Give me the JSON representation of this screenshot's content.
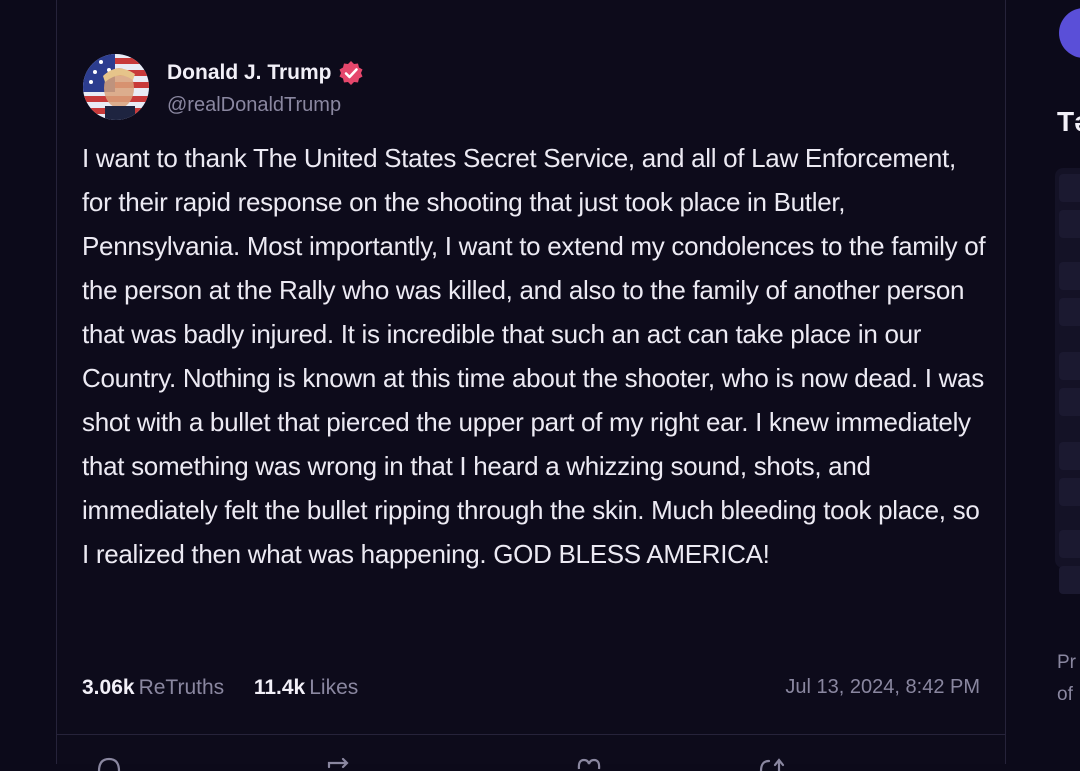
{
  "post": {
    "author": {
      "display_name": "Donald J. Trump",
      "handle": "@realDonaldTrump",
      "verified": true,
      "verified_color": "#e5476c"
    },
    "text": "I want to thank The United States Secret Service, and all of Law Enforcement, for their rapid response on the shooting that just took place in Butler, Pennsylvania. Most importantly, I want to extend my condolences to the family of the person at the Rally who was killed, and also to the family of another person that was badly injured. It is incredible that such an act can take place in our Country. Nothing is known at this time about the shooter, who is now dead. I was shot with a bullet that pierced the upper part of my right ear. I knew immediately that something was wrong in that I heard a whizzing sound, shots, and immediately felt the bullet ripping through the skin. Much bleeding took place, so I realized then what was happening. GOD BLESS AMERICA!",
    "stats": {
      "retruths_count": "3.06k",
      "retruths_label": "ReTruths",
      "likes_count": "11.4k",
      "likes_label": "Likes"
    },
    "timestamp": "Jul 13, 2024, 8:42 PM",
    "actions": [
      "reply-icon",
      "retruth-icon",
      "like-icon",
      "share-icon"
    ]
  },
  "sidebar": {
    "heading": "Tǝ",
    "footer_line1": "Pr",
    "footer_line2": "of"
  },
  "colors": {
    "background": "#0c0a1a",
    "text": "#eceaf3",
    "muted": "#8a87a0",
    "accent": "#5a4fd8"
  }
}
